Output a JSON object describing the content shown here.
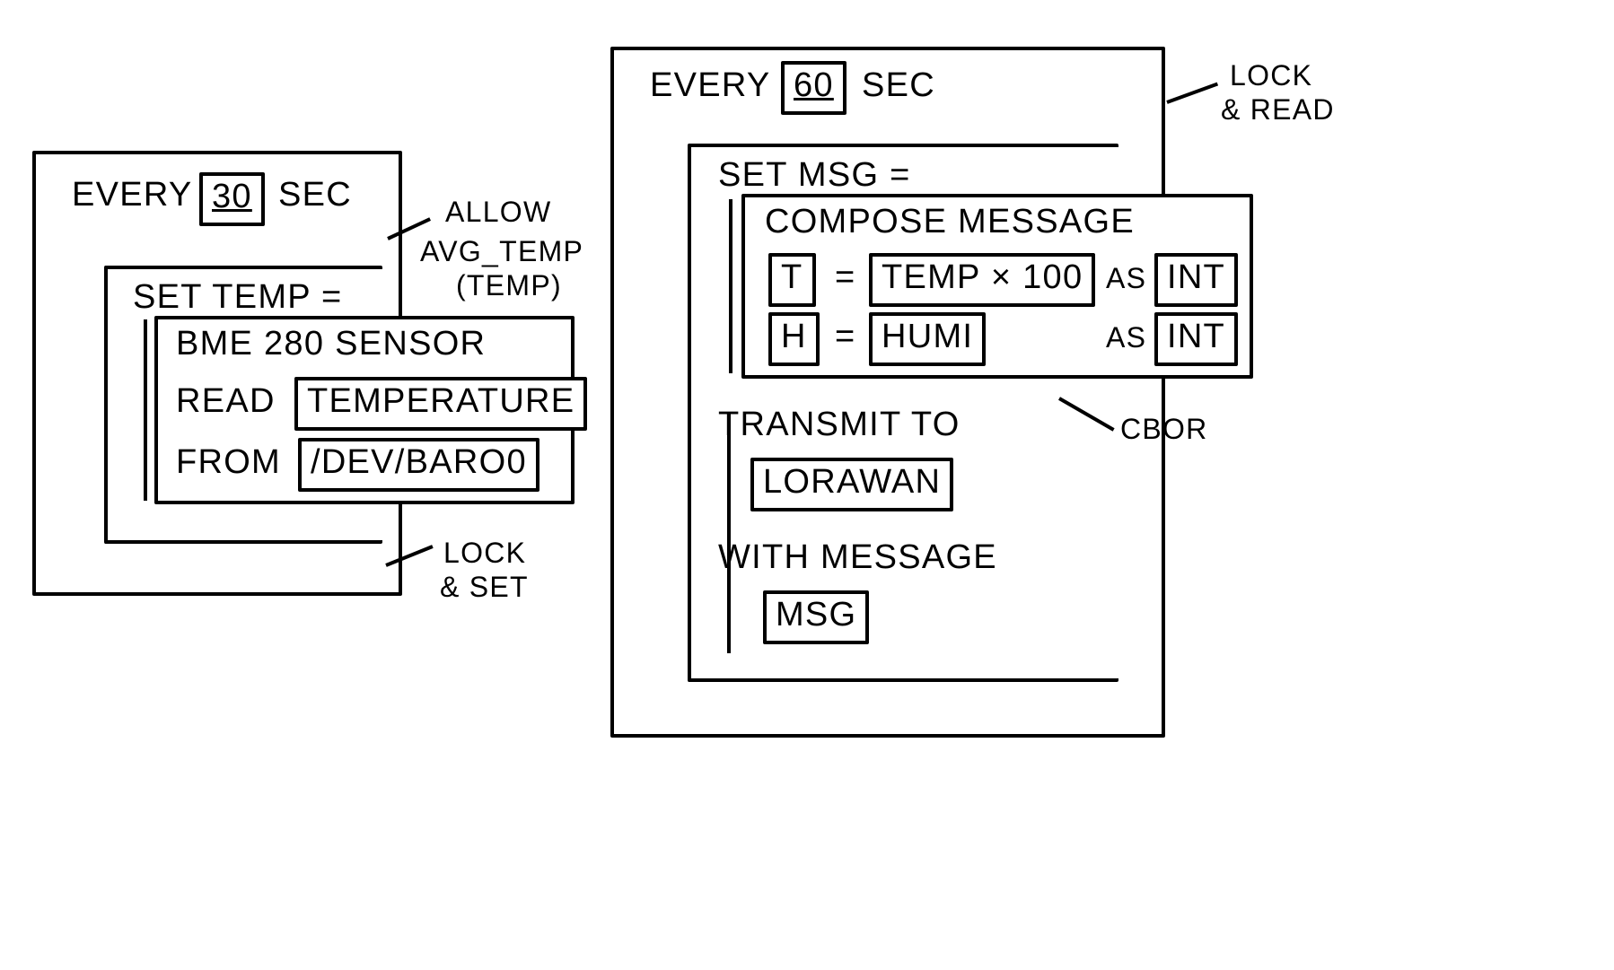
{
  "left": {
    "every_label": "EVERY",
    "every_value": "30",
    "every_unit": "SEC",
    "annotation_top_1": "ALLOW",
    "annotation_top_2": "AVG_TEMP",
    "annotation_top_3": "(TEMP)",
    "set_label": "SET  TEMP =",
    "sensor_title": "BME 280 SENSOR",
    "read_label": "READ",
    "read_value": "TEMPERATURE",
    "from_label": "FROM",
    "from_value": "/DEV/BARO0",
    "annotation_bottom_1": "LOCK",
    "annotation_bottom_2": "& SET"
  },
  "right": {
    "every_label": "EVERY",
    "every_value": "60",
    "every_unit": "SEC",
    "annotation_top_1": "LOCK",
    "annotation_top_2": "& READ",
    "set_label": "SET  MSG =",
    "compose_title": "COMPOSE  MESSAGE",
    "row1_key": "T",
    "row1_eq": "=",
    "row1_expr": "TEMP × 100",
    "row1_as": "AS",
    "row1_type": "INT",
    "row2_key": "H",
    "row2_eq": "=",
    "row2_expr": "HUMI",
    "row2_as": "AS",
    "row2_type": "INT",
    "annotation_cbor": "CBOR",
    "transmit_label": "TRANSMIT  TO",
    "transmit_value": "LORAWAN",
    "with_label": "WITH  MESSAGE",
    "with_value": "MSG"
  }
}
